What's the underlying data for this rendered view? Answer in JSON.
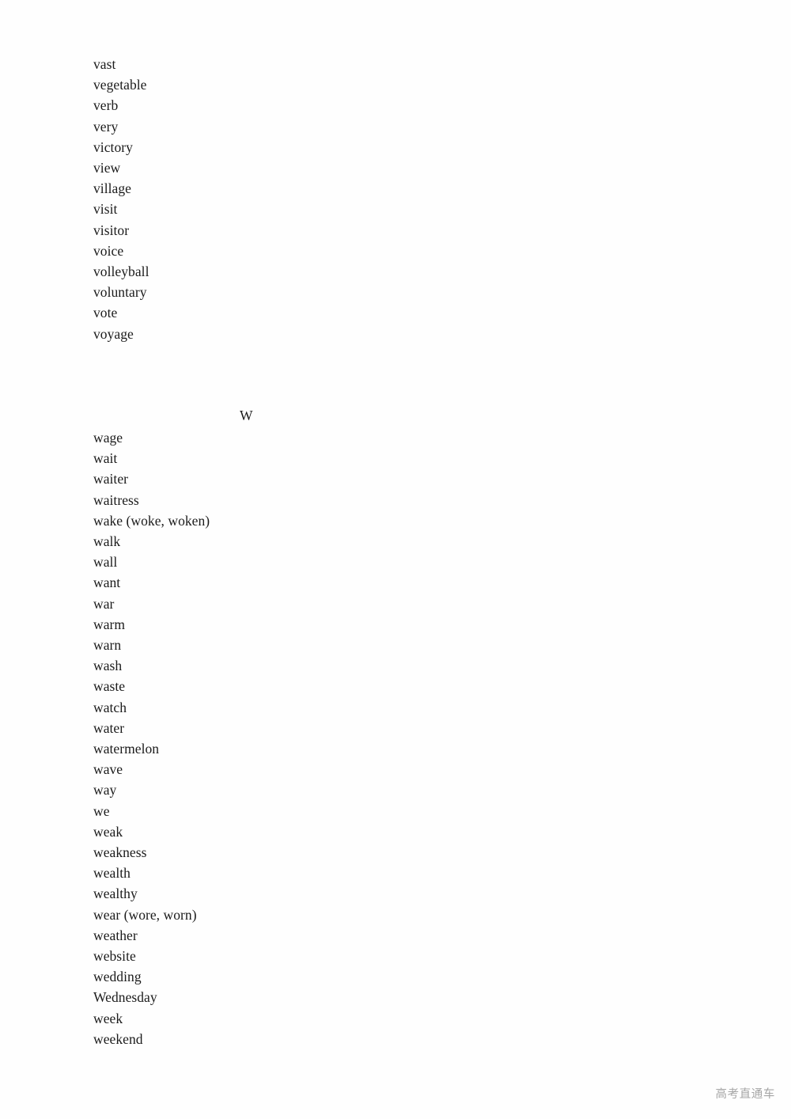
{
  "document": {
    "type": "vocabulary-word-list",
    "page_background": "#fefefe",
    "text_color": "#1b1b1b"
  },
  "sections": [
    {
      "id": "v",
      "heading": "",
      "heading_visible": false,
      "words": [
        "vast",
        "vegetable",
        "verb",
        "very",
        "victory",
        "view",
        "village",
        "visit",
        "visitor",
        "voice",
        "volleyball",
        "voluntary",
        "vote",
        "voyage"
      ]
    },
    {
      "id": "w",
      "heading": "W",
      "heading_visible": true,
      "words": [
        "wage",
        "wait",
        "waiter",
        "waitress",
        "wake (woke, woken)",
        "walk",
        "wall",
        "want",
        "war",
        "warm",
        "warn",
        "wash",
        "waste",
        "watch",
        "water",
        "watermelon",
        "wave",
        "way",
        "we",
        "weak",
        "weakness",
        "wealth",
        "wealthy",
        "wear (wore, worn)",
        "weather",
        "website",
        "wedding",
        "Wednesday",
        "week",
        "weekend"
      ]
    }
  ],
  "watermark": {
    "text": "高考直通车",
    "color": "#a6a6a6"
  }
}
